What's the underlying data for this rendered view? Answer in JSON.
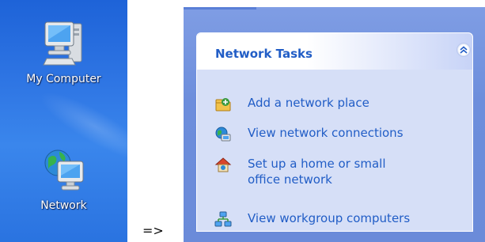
{
  "desktop": {
    "icons": [
      {
        "label": "My Computer",
        "icon": "my-computer-icon"
      },
      {
        "label": "Network",
        "icon": "network-icon"
      }
    ]
  },
  "arrow": "=>",
  "task_pane": {
    "title": "Network Tasks",
    "collapse_icon": "double-chevron-up-icon",
    "tasks": [
      {
        "label": "Add a network place",
        "icon": "add-network-place-icon"
      },
      {
        "label": "View network connections",
        "icon": "network-connections-icon"
      },
      {
        "label": "Set up a home or small office network",
        "line1": "Set up a home or small",
        "line2": "office network",
        "icon": "home-network-icon"
      },
      {
        "label": "View workgroup computers",
        "icon": "workgroup-computers-icon"
      }
    ]
  },
  "colors": {
    "desktop_blue": "#2f76e4",
    "pane_blue": "#6d8edc",
    "link_blue": "#215dc6",
    "box_bg": "#d6dff7"
  }
}
